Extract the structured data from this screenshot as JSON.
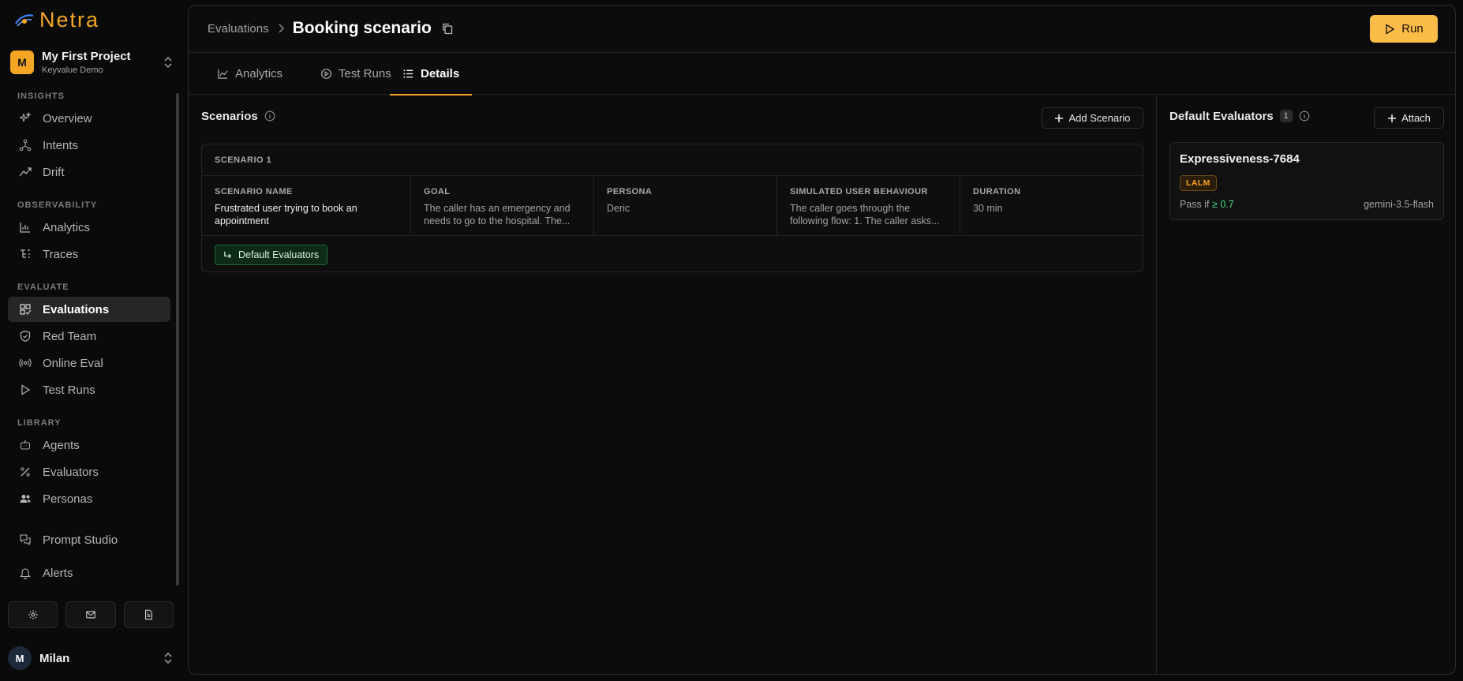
{
  "app": {
    "logo_text": "Netra"
  },
  "project": {
    "initial": "M",
    "name": "My First Project",
    "subtitle": "Keyvalue Demo"
  },
  "nav": {
    "insights": {
      "label": "INSIGHTS",
      "items": [
        "Overview",
        "Intents",
        "Drift"
      ]
    },
    "observability": {
      "label": "OBSERVABILITY",
      "items": [
        "Analytics",
        "Traces"
      ]
    },
    "evaluate": {
      "label": "EVALUATE",
      "items": [
        "Evaluations",
        "Red Team",
        "Online Eval",
        "Test Runs"
      ]
    },
    "library": {
      "label": "LIBRARY",
      "items": [
        "Agents",
        "Evaluators",
        "Personas"
      ]
    },
    "other": [
      "Prompt Studio",
      "Alerts"
    ],
    "active": "Evaluations"
  },
  "user": {
    "initial": "M",
    "name": "Milan"
  },
  "header": {
    "breadcrumb_parent": "Evaluations",
    "title": "Booking scenario",
    "run_label": "Run"
  },
  "tabs": [
    "Analytics",
    "Test Runs",
    "Details"
  ],
  "active_tab": "Details",
  "scenarios": {
    "title": "Scenarios",
    "add_label": "Add Scenario",
    "card": {
      "header": "SCENARIO 1",
      "columns": [
        {
          "label": "SCENARIO NAME",
          "value": "Frustrated user trying to book an appointment"
        },
        {
          "label": "GOAL",
          "value": "The caller has an emergency and needs to go to the hospital. The..."
        },
        {
          "label": "PERSONA",
          "value": "Deric"
        },
        {
          "label": "SIMULATED USER BEHAVIOUR",
          "value": "The caller goes through the following flow: 1. The caller asks..."
        },
        {
          "label": "DURATION",
          "value": "30 min"
        }
      ],
      "chip_label": "Default Evaluators"
    }
  },
  "default_evaluators": {
    "title": "Default Evaluators",
    "count": "1",
    "attach_label": "Attach",
    "items": [
      {
        "name": "Expressiveness-7684",
        "tag": "LALM",
        "pass_prefix": "Pass if",
        "threshold": "≥ 0.7",
        "model": "gemini-3.5-flash"
      }
    ]
  },
  "colors": {
    "accent": "#f5a524",
    "run_button": "#fbbd48",
    "success": "#4ade80",
    "chip_bg": "#0e2a18"
  }
}
